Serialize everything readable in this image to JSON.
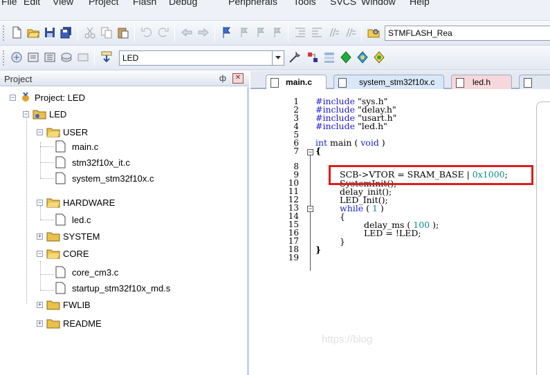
{
  "menu": [
    "File",
    "Edit",
    "View",
    "Project",
    "Flash",
    "Debug",
    "Peripherals",
    "Tools",
    "SVCS",
    "Window",
    "Help"
  ],
  "toolbar": {
    "flash_combo": "STMFLASH_Rea",
    "target_combo": "LED"
  },
  "project_panel": {
    "title": "Project",
    "pin_glyph": "ф",
    "close_glyph": "✕",
    "tree": {
      "root": "Project: LED",
      "target": "LED",
      "groups": {
        "user": "USER",
        "hardware": "HARDWARE",
        "system": "SYSTEM",
        "core": "CORE",
        "fwlib": "FWLIB",
        "readme": "README"
      },
      "files": {
        "main": "main.c",
        "stm32_it": "stm32f10x_it.c",
        "system_stm32": "system_stm32f10x.c",
        "led": "led.c",
        "core_cm3": "core_cm3.c",
        "startup": "startup_stm32f10x_md.s"
      }
    }
  },
  "editor": {
    "tabs": [
      "main.c",
      "system_stm32f10x.c",
      "led.h"
    ],
    "line_numbers": [
      "1",
      "2",
      "3",
      "4",
      "5",
      "6",
      "7",
      "8",
      "9",
      "10",
      "11",
      "12",
      "13",
      "14",
      "15",
      "16",
      "17",
      "18",
      "19"
    ],
    "lines": {
      "l1_kw": "#include",
      "l1_str": " \"sys.h\"",
      "l2_kw": "#include",
      "l2_str": " \"delay.h\"",
      "l3_kw": "#include",
      "l3_str": " \"usart.h\"",
      "l4_kw": "#include",
      "l4_str": " \"led.h\"",
      "l6_kw1": "int",
      "l6_mid": " main ( ",
      "l6_kw2": "void",
      "l6_end": " )",
      "l7": "{",
      "l8_a": "SCB->VTOR = SRAM_BASE | ",
      "l8_num": "0x1000",
      "l8_end": ";",
      "l9": "SystemInit();",
      "l10": "delay_init();",
      "l11": "LED_Init();",
      "l12_kw": "while",
      "l12_mid": " ( ",
      "l12_num": "1",
      "l12_end": " )",
      "l13": "{",
      "l14_a": "delay_ms ( ",
      "l14_num": "100",
      "l14_end": " );",
      "l15": "LED = !LED;",
      "l16": "}",
      "l17": "}"
    },
    "watermark": "https://blog"
  },
  "colors": {
    "keyword": "#1b1bd6",
    "number": "#0a8a8a",
    "highlight_box": "#e01b1b"
  }
}
